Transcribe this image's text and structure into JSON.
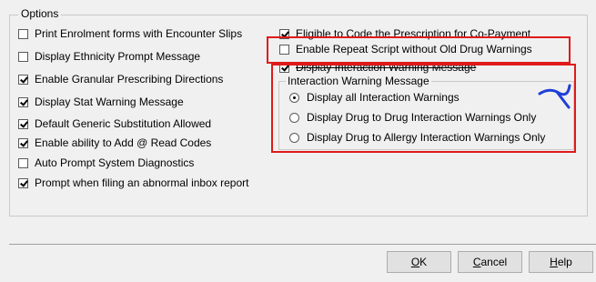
{
  "options": {
    "group_label": "Options",
    "left_column": [
      {
        "label": "Print Enrolment forms with Encounter Slips",
        "checked": false
      },
      {
        "label": "Display Ethnicity Prompt Message",
        "checked": false
      },
      {
        "label": "Enable Granular Prescribing Directions",
        "checked": true
      },
      {
        "label": "Display Stat Warning Message",
        "checked": true
      },
      {
        "label": "Default Generic Substitution Allowed",
        "checked": true
      },
      {
        "label": "Enable ability to Add @ Read Codes",
        "checked": true
      },
      {
        "label": "Auto Prompt System Diagnostics",
        "checked": false
      },
      {
        "label": "Prompt when filing an abnormal inbox report",
        "checked": true
      }
    ],
    "right_column": [
      {
        "label": "Eligible to Code the Prescription for Co-Payment",
        "checked": true
      },
      {
        "label": "Enable Repeat Script without Old Drug Warnings",
        "checked": false
      },
      {
        "label": "Display Interaction Warning Message",
        "checked": true
      }
    ],
    "interaction_group": {
      "label": "Interaction Warning Message",
      "radios": [
        {
          "label": "Display all Interaction Warnings",
          "selected": true
        },
        {
          "label": "Display Drug to Drug Interaction Warnings Only",
          "selected": false
        },
        {
          "label": "Display Drug to Allergy Interaction Warnings Only",
          "selected": false
        }
      ]
    }
  },
  "buttons": {
    "ok": {
      "accel": "O",
      "rest": "K"
    },
    "cancel": {
      "accel": "C",
      "rest": "ancel"
    },
    "help": {
      "accel": "H",
      "rest": "elp"
    }
  },
  "annotations": {
    "highlight_color": "#e01a1a",
    "pen_color": "#1f3fd6"
  }
}
